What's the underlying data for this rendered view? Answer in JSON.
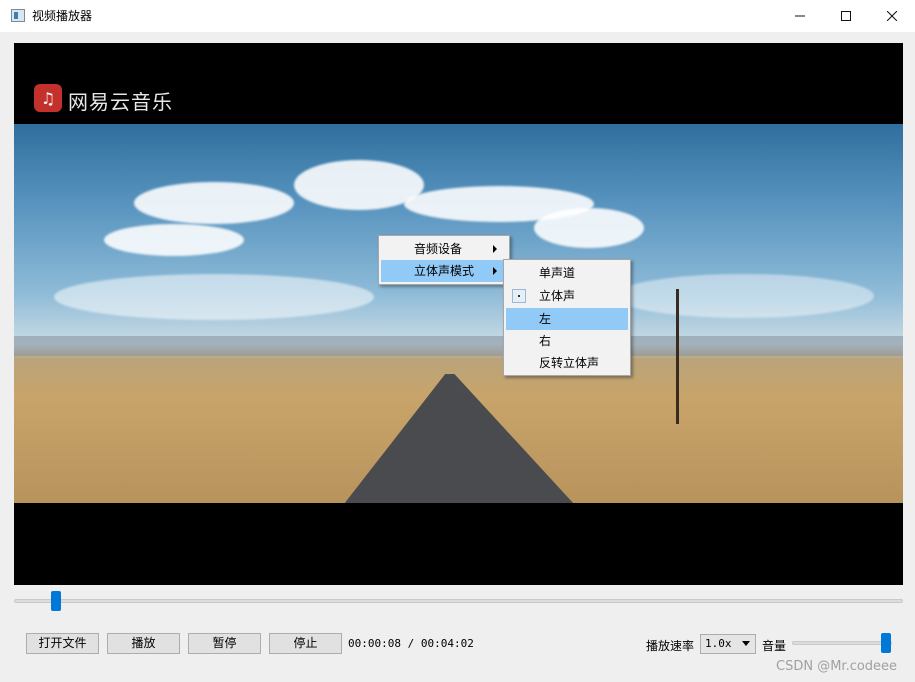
{
  "window": {
    "title": "视频播放器",
    "min_icon": "minimize-icon",
    "max_icon": "maximize-icon",
    "close_icon": "close-icon"
  },
  "video": {
    "logo_text": "网易云音乐",
    "logo_icon": "netease-music-icon",
    "logo_color": "#c4302b"
  },
  "context_menu": {
    "items": [
      {
        "label": "音频设备",
        "has_submenu": true
      },
      {
        "label": "立体声模式",
        "has_submenu": true,
        "highlighted": true
      }
    ],
    "submenu": {
      "items": [
        {
          "label": "单声道"
        },
        {
          "label": "立体声",
          "checked": true
        },
        {
          "label": "左",
          "highlighted": true
        },
        {
          "label": "右"
        },
        {
          "label": "反转立体声"
        }
      ]
    },
    "highlight_color": "#91c9f7"
  },
  "playback": {
    "progress_fraction": 0.033,
    "time_text": "00:00:08 / 00:04:02"
  },
  "controls": {
    "open_file": "打开文件",
    "play": "播放",
    "pause": "暂停",
    "stop": "停止",
    "rate_label": "播放速率",
    "rate_value": "1.0x",
    "volume_label": "音量",
    "volume_fraction": 1.0,
    "accent_color": "#0078d7"
  },
  "watermark": "CSDN @Mr.codeee"
}
